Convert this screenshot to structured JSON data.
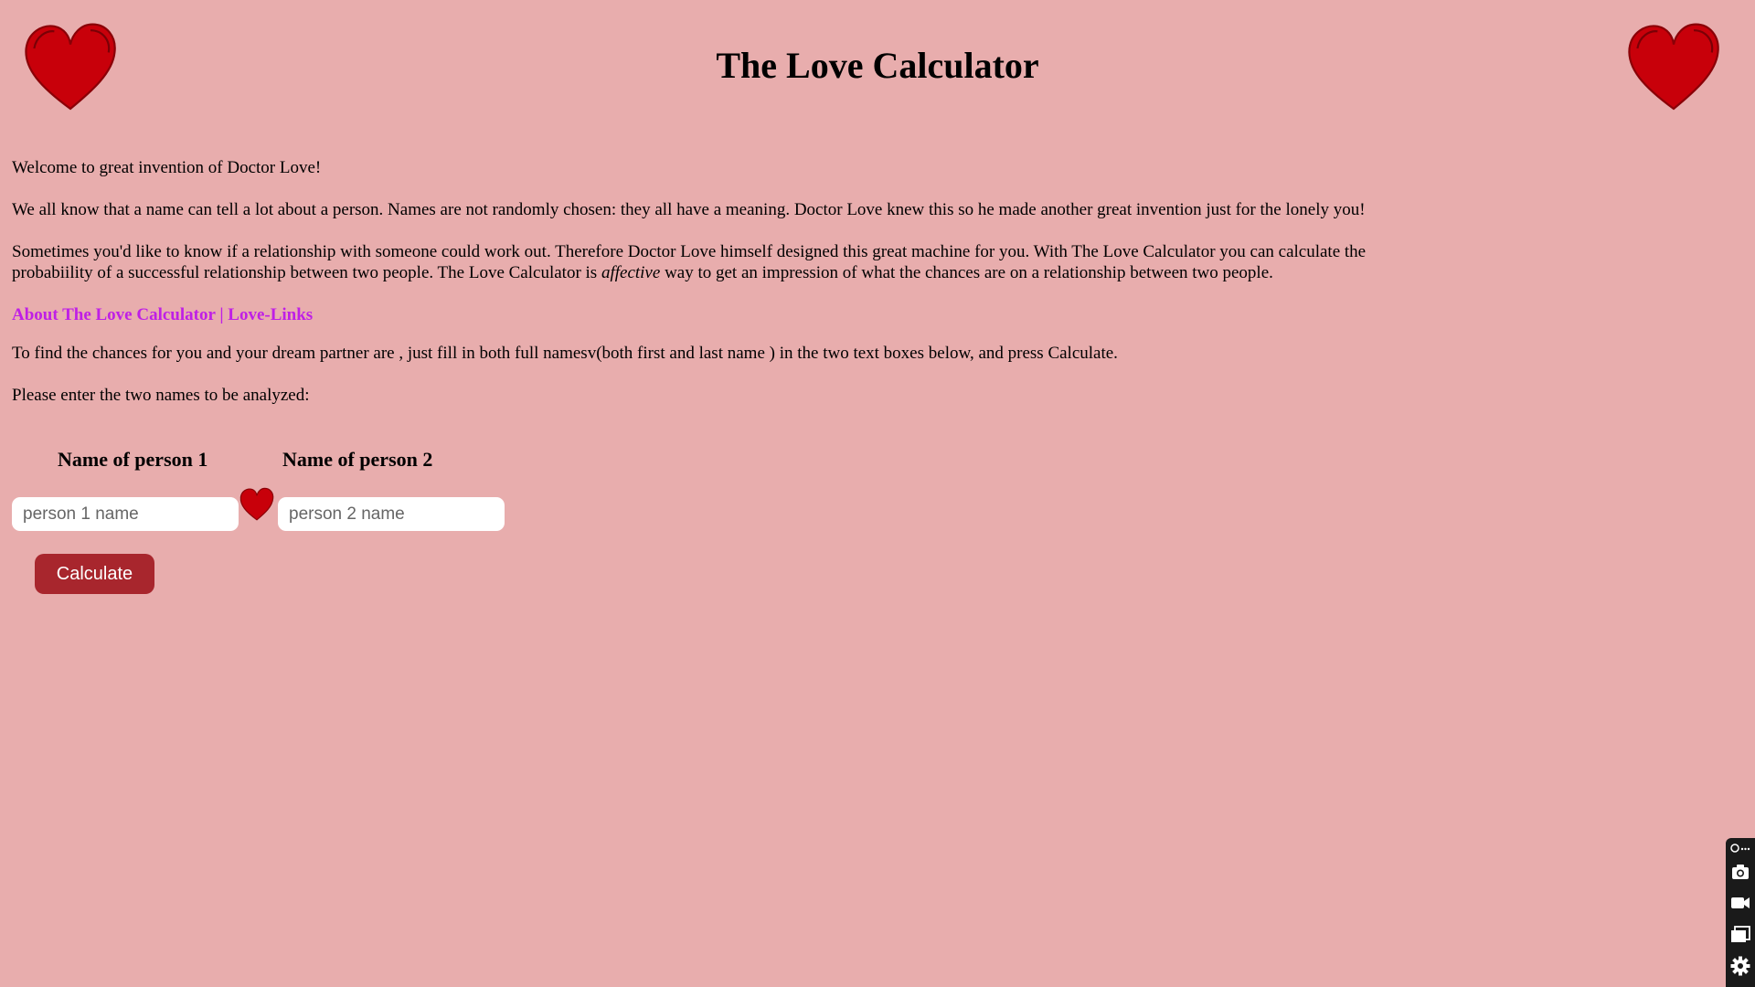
{
  "header": {
    "title": "The Love Calculator"
  },
  "intro": {
    "welcome": "Welcome to great invention of Doctor Love!",
    "paragraph1": "We all know that a name can tell a lot about a person. Names are not randomly chosen: they all have a meaning. Doctor Love knew this so he made another great invention just for the lonely you!",
    "paragraph2_before": "Sometimes you'd like to know if a relationship with someone could work out. Therefore Doctor Love himself designed this great machine for you. With The Love Calculator you can calculate the probabiility of a successful relationship between two people. The Love Calculator is ",
    "paragraph2_italic": "affective",
    "paragraph2_after": " way to get an impression of what the chances are on a relationship between two people."
  },
  "links": {
    "about": "About The Love Calculator",
    "separator": " | ",
    "love_links": "Love-Links"
  },
  "instructions": {
    "line1": "To find the chances for you and your dream partner are , just fill in both full namesv(both first and last name ) in the two text boxes below, and press Calculate.",
    "line2": "Please enter the two names to be analyzed:"
  },
  "form": {
    "label1": "Name of person 1",
    "label2": "Name of person 2",
    "placeholder1": "person 1 name",
    "placeholder2": "person 2 name",
    "value1": "",
    "value2": "",
    "button_label": "Calculate"
  },
  "icons": {
    "corner_heart": "heart-icon",
    "mid_heart": "heart-icon",
    "toolbar": [
      "extension-icon",
      "camera-icon",
      "video-icon",
      "window-icon",
      "gear-icon"
    ]
  },
  "colors": {
    "background": "#e8adad",
    "link": "#bf1fe6",
    "button": "#a8262d",
    "heart": "#c8000a"
  }
}
